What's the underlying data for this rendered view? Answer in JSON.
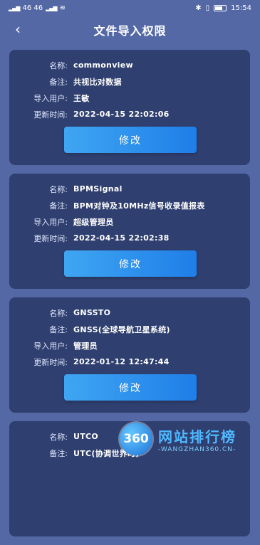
{
  "status": {
    "left_text": "46 46",
    "time": "15:54"
  },
  "header": {
    "title": "文件导入权限"
  },
  "labels": {
    "name": "名称:",
    "note": "备注:",
    "user": "导入用户:",
    "time": "更新时间:",
    "edit": "修改"
  },
  "cards": [
    {
      "name": "commonview",
      "note": "共视比对数据",
      "user": "王敏",
      "time": "2022-04-15 22:02:06"
    },
    {
      "name": "BPMSignal",
      "note": "BPM对钟及10MHz信号收录值报表",
      "user": "超级管理员",
      "time": "2022-04-15 22:02:38"
    },
    {
      "name": "GNSSTO",
      "note": "GNSS(全球导航卫星系统)",
      "user": "管理员",
      "time": "2022-01-12 12:47:44"
    },
    {
      "name": "UTCO",
      "note": "UTC(协调世界时)"
    }
  ],
  "watermark": {
    "logo_text": "360",
    "cn": "网站排行榜",
    "en": "-WANGZHAN360.CN-"
  }
}
